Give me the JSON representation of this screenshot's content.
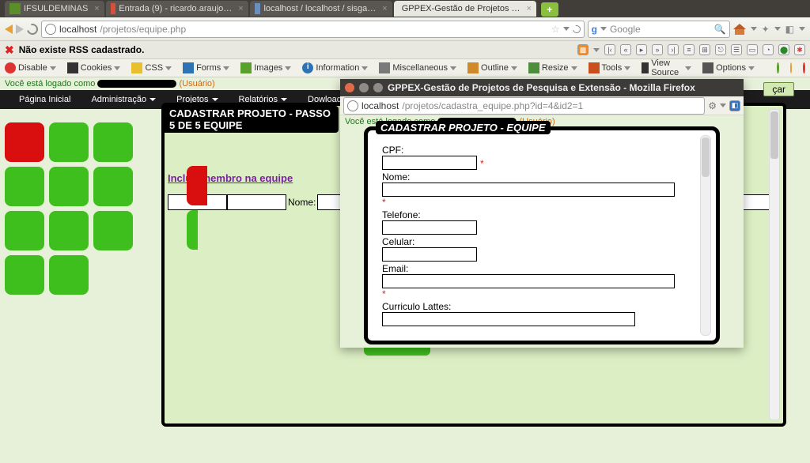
{
  "browser": {
    "tabs": [
      {
        "label": "IFSULDEMINAS",
        "favicon": "fav-green"
      },
      {
        "label": "Entrada (9) - ricardo.araujo…",
        "favicon": "fav-gmail"
      },
      {
        "label": "localhost / localhost / sisga…",
        "favicon": "fav-pma"
      },
      {
        "label": "GPPEX-Gestão de Projetos …",
        "favicon": "fav-generic",
        "active": true
      }
    ],
    "address_host": "localhost",
    "address_path": "/projetos/equipe.php",
    "search_engine_label": "Google",
    "search_placeholder": "",
    "rss_message": "Não existe RSS cadastrado."
  },
  "devbar": {
    "items": [
      "Disable",
      "Cookies",
      "CSS",
      "Forms",
      "Images",
      "Information",
      "Miscellaneous",
      "Outline",
      "Resize",
      "Tools",
      "View Source",
      "Options"
    ]
  },
  "page": {
    "logged_prefix": "Você está logado como",
    "role": "(Usuário)",
    "menu": [
      "Página Inicial",
      "Administração",
      "Projetos",
      "Relatórios",
      "Dowloads"
    ],
    "panel_title": "CADASTRAR PROJETO - PASSO 5 DE 5 EQUIPE",
    "include_link": "Incluir membro na equipe",
    "col_nome": "Nome:"
  },
  "popup": {
    "window_title": "GPPEX-Gestão de Projetos de Pesquisa e Extensão - Mozilla Firefox",
    "address_host": "localhost",
    "address_path": "/projetos/cadastra_equipe.php?id=4&id2=1",
    "logged_prefix": "Você está logado como",
    "role": "(Usuário)",
    "form_title": "CADASTRAR PROJETO - EQUIPE",
    "fields": {
      "cpf": "CPF:",
      "nome": "Nome:",
      "telefone": "Telefone:",
      "celular": "Celular:",
      "email": "Email:",
      "lattes": "Curriculo Lattes:"
    },
    "under_button": "çar"
  }
}
